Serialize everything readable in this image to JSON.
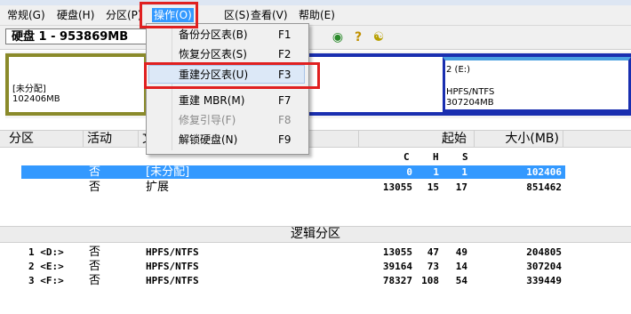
{
  "menubar": {
    "items": [
      "常规(G)",
      "硬盘(H)",
      "分区(P)",
      "操作(O)",
      "分区(S)",
      "查看(V)",
      "帮助(E)"
    ],
    "partial_item": "区(S)"
  },
  "toolbar": {
    "disk_selector": "硬盘 1 - 953869MB"
  },
  "diskmap": {
    "unallocated": {
      "line1": "[未分配]",
      "line2": "102406MB"
    },
    "partition_e": {
      "line1": "2 (E:)",
      "line2": "HPFS/NTFS",
      "line3": "307204MB"
    }
  },
  "dropdown": {
    "items": [
      {
        "label": "备份分区表(B)",
        "key": "F1"
      },
      {
        "label": "恢复分区表(S)",
        "key": "F2"
      },
      {
        "label": "重建分区表(U)",
        "key": "F3"
      },
      {
        "label": "重建 MBR(M)",
        "key": "F7"
      },
      {
        "label": "修复引导(F)",
        "key": "F8"
      },
      {
        "label": "解锁硬盘(N)",
        "key": "F9"
      }
    ]
  },
  "table": {
    "headers": [
      "分区",
      "活动",
      "文",
      "起始",
      "大小(MB)"
    ],
    "chs_headers": [
      "C",
      "H",
      "S"
    ],
    "primary_rows": [
      {
        "partition": "",
        "active": "否",
        "type": "[未分配]",
        "c": "0",
        "h": "1",
        "s": "1",
        "size": "102406"
      },
      {
        "partition": "",
        "active": "否",
        "type": "扩展",
        "c": "13055",
        "h": "15",
        "s": "17",
        "size": "851462"
      }
    ],
    "logical_title": "逻辑分区",
    "logical_rows": [
      {
        "partition": "1 <D:>",
        "active": "否",
        "type": "HPFS/NTFS",
        "c": "13055",
        "h": "47",
        "s": "49",
        "size": "204805"
      },
      {
        "partition": "2 <E:>",
        "active": "否",
        "type": "HPFS/NTFS",
        "c": "39164",
        "h": "73",
        "s": "14",
        "size": "307204"
      },
      {
        "partition": "3 <F:>",
        "active": "否",
        "type": "HPFS/NTFS",
        "c": "78327",
        "h": "108",
        "s": "54",
        "size": "339449"
      }
    ]
  },
  "icons": [
    "globe-icon",
    "help-icon",
    "cart-icon"
  ],
  "colors": {
    "highlight": "#3399ff",
    "annotation": "#e02020",
    "extended_border": "#1a2fb0",
    "unallocated_border": "#8a8a2a"
  }
}
